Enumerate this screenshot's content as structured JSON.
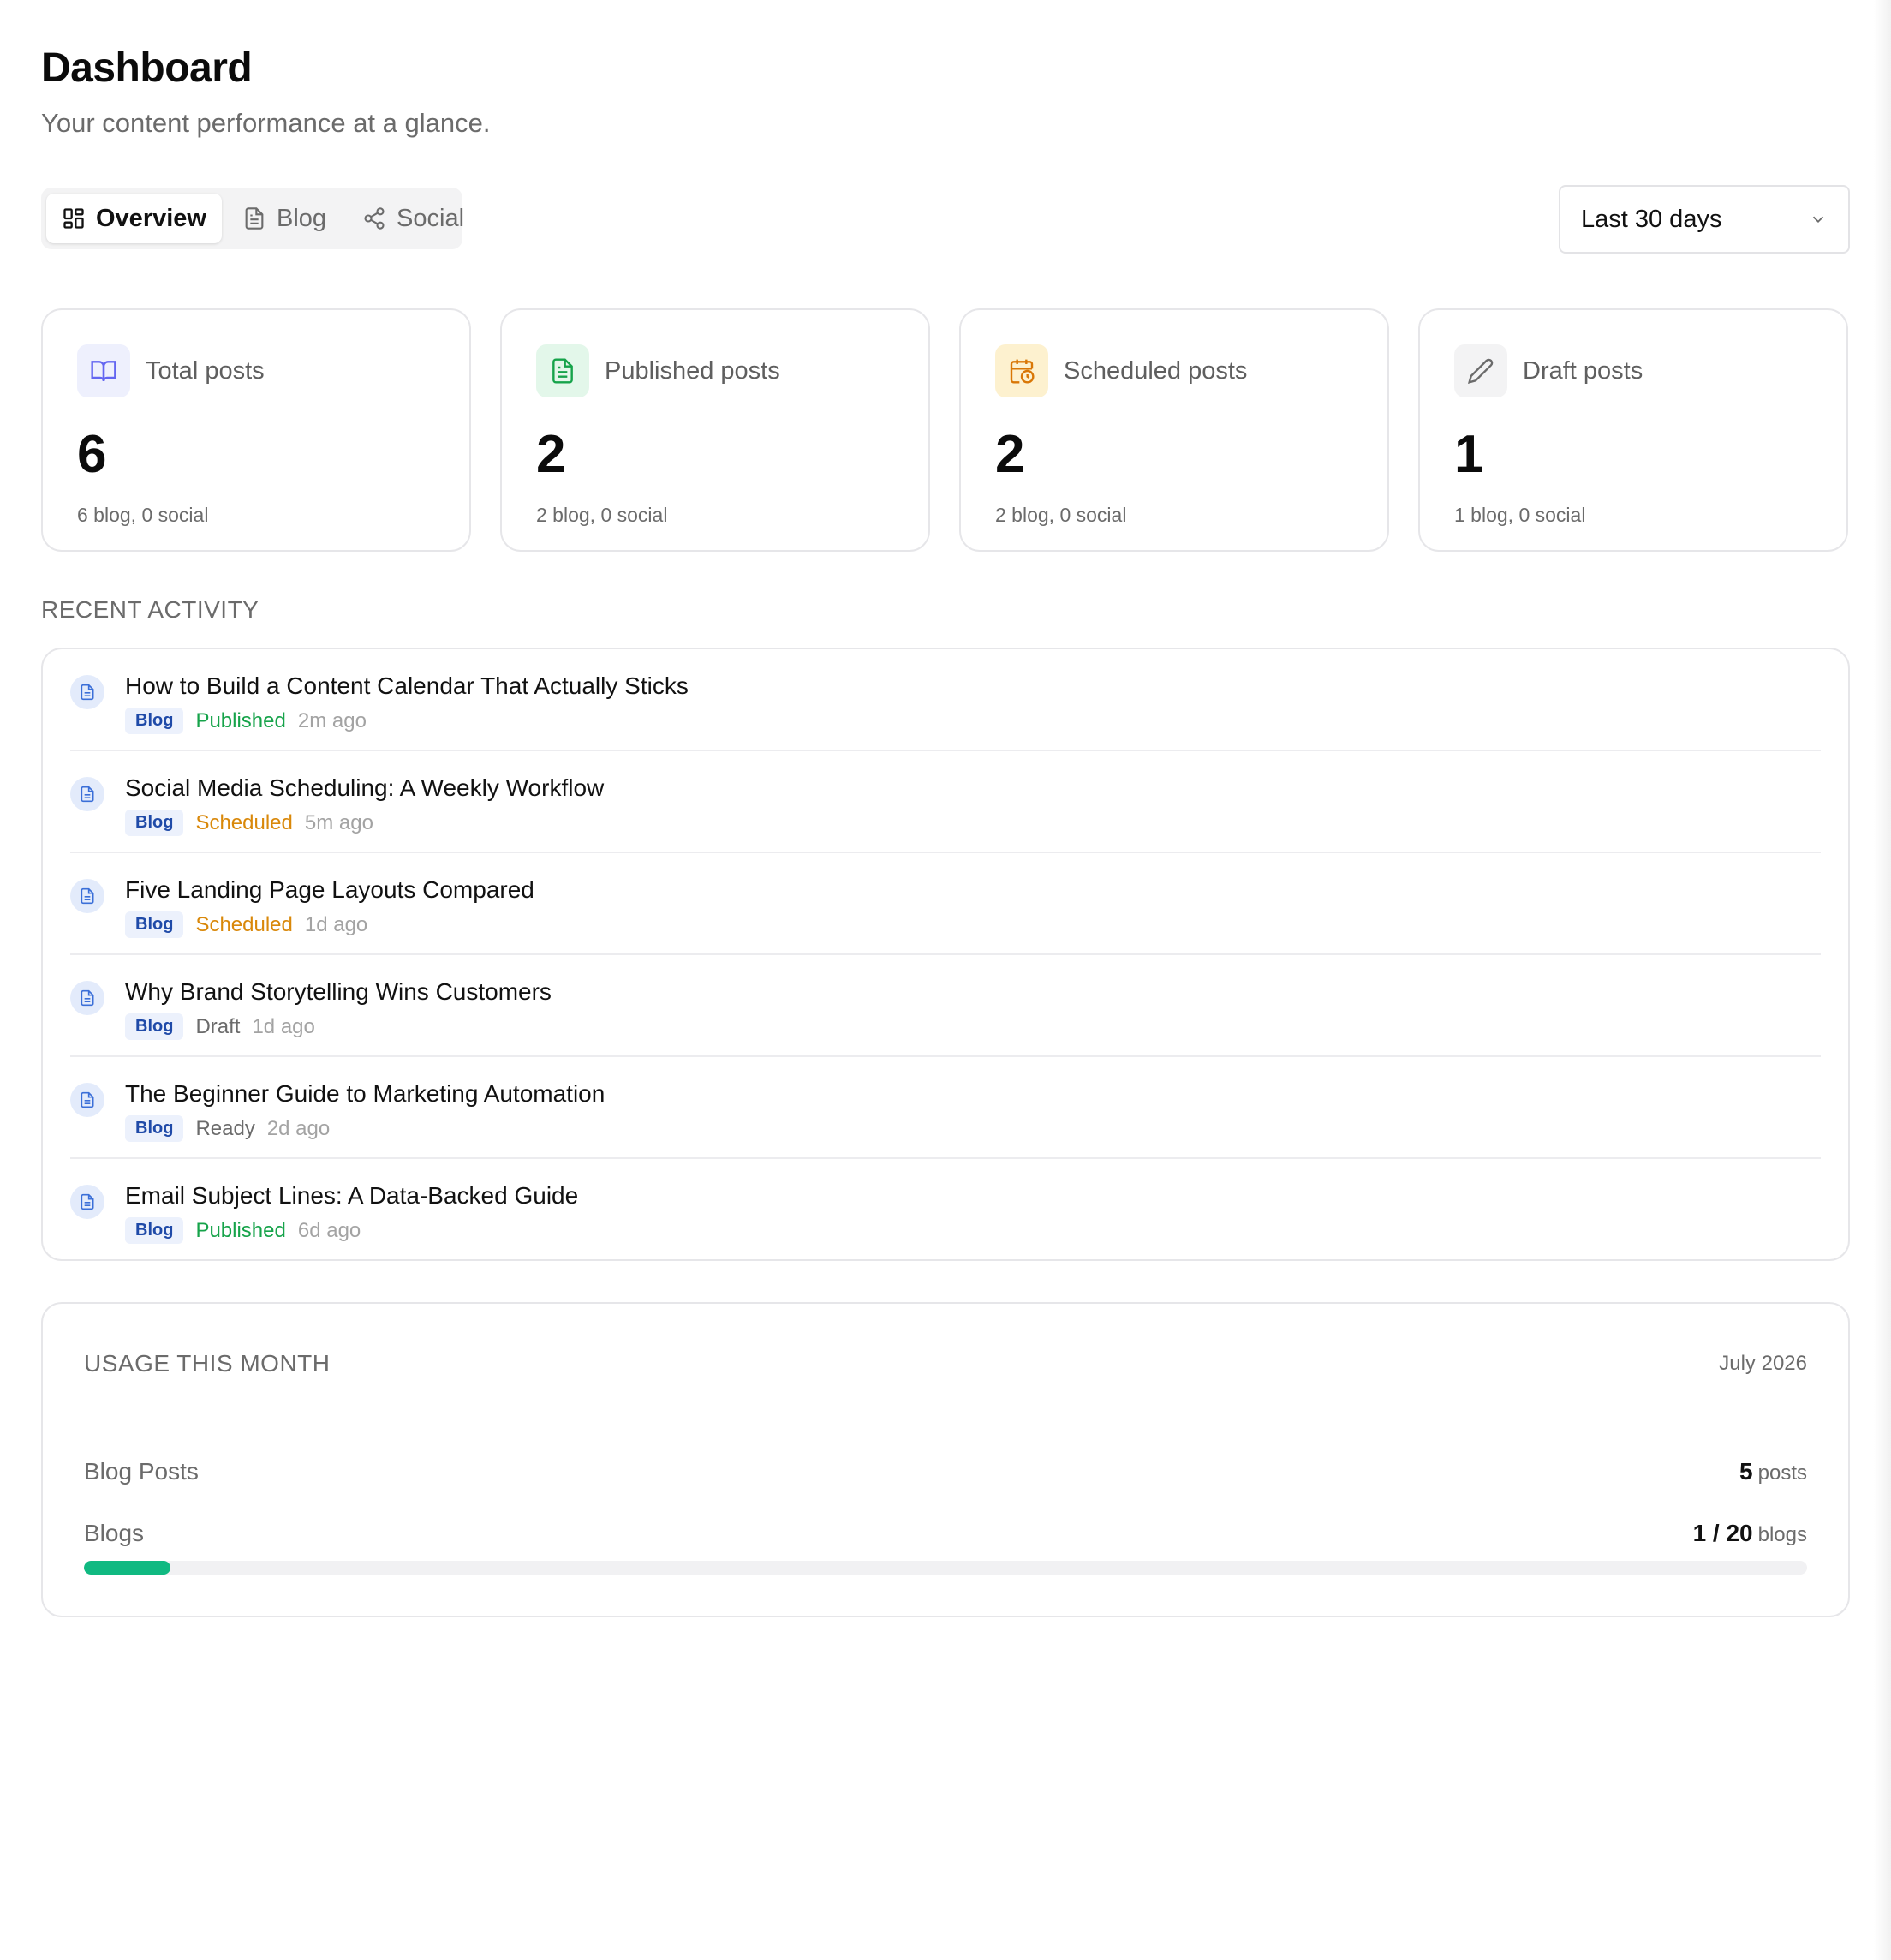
{
  "header": {
    "title": "Dashboard",
    "subtitle": "Your content performance at a glance."
  },
  "tabs": [
    {
      "label": "Overview",
      "icon": "grid-icon",
      "active": true
    },
    {
      "label": "Blog",
      "icon": "document-icon",
      "active": false
    },
    {
      "label": "Social",
      "icon": "share-icon",
      "active": false
    }
  ],
  "range": {
    "selected": "Last 30 days"
  },
  "cards": [
    {
      "label": "Total posts",
      "value": "6",
      "sub": "6 blog, 0 social",
      "icon": "book-icon",
      "color": "#6366f1",
      "bg": "#eef0fd"
    },
    {
      "label": "Published posts",
      "value": "2",
      "sub": "2 blog, 0 social",
      "icon": "file-text-icon",
      "color": "#16a34a",
      "bg": "#e3f7ea"
    },
    {
      "label": "Scheduled posts",
      "value": "2",
      "sub": "2 blog, 0 social",
      "icon": "calendar-clock-icon",
      "color": "#d97706",
      "bg": "#fdf1cf"
    },
    {
      "label": "Draft posts",
      "value": "1",
      "sub": "1 blog, 0 social",
      "icon": "pencil-icon",
      "color": "#6b6b6b",
      "bg": "#f3f3f4"
    }
  ],
  "recent": {
    "label": "RECENT ACTIVITY",
    "items": [
      {
        "title": "How to Build a Content Calendar That Actually Sticks",
        "badge": "Blog",
        "status": "Published",
        "time": "2m ago"
      },
      {
        "title": "Social Media Scheduling: A Weekly Workflow",
        "badge": "Blog",
        "status": "Scheduled",
        "time": "5m ago"
      },
      {
        "title": "Five Landing Page Layouts Compared",
        "badge": "Blog",
        "status": "Scheduled",
        "time": "1d ago"
      },
      {
        "title": "Why Brand Storytelling Wins Customers",
        "badge": "Blog",
        "status": "Draft",
        "time": "1d ago"
      },
      {
        "title": "The Beginner Guide to Marketing Automation",
        "badge": "Blog",
        "status": "Ready",
        "time": "2d ago"
      },
      {
        "title": "Email Subject Lines: A Data-Backed Guide",
        "badge": "Blog",
        "status": "Published",
        "time": "6d ago"
      }
    ]
  },
  "usage": {
    "title": "USAGE THIS MONTH",
    "month": "July 2026",
    "blog_posts": {
      "label": "Blog Posts",
      "value": "5",
      "unit": "posts"
    },
    "blogs": {
      "label": "Blogs",
      "value": "1 / 20",
      "unit": "blogs",
      "progress": 0.05
    },
    "accent": "#10b981"
  }
}
